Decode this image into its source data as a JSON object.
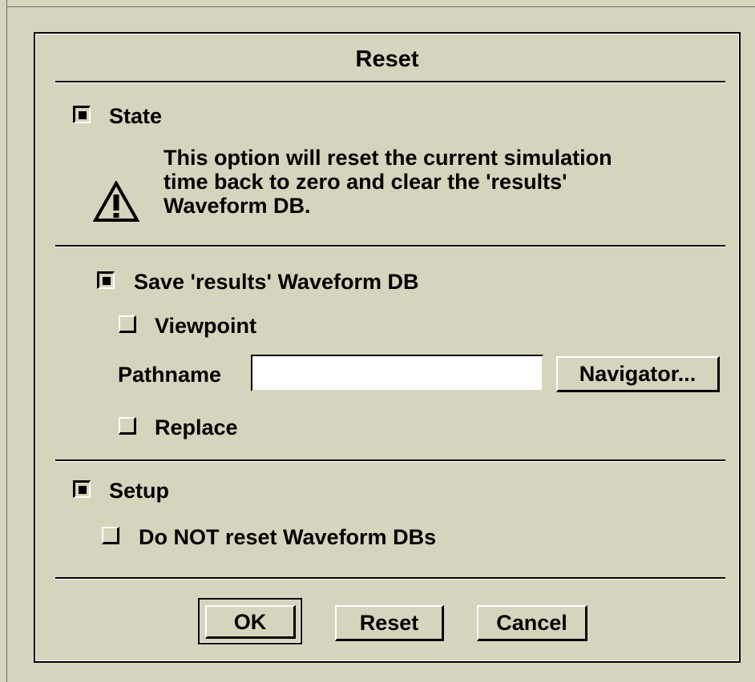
{
  "dialog": {
    "title": "Reset"
  },
  "state": {
    "checked": true,
    "label": "State",
    "warning_icon": "warning-triangle-icon",
    "warning_lines": [
      "This option will reset the current simulation",
      "time back to zero and clear the 'results'",
      "Waveform DB."
    ]
  },
  "save": {
    "checked": true,
    "label": "Save 'results' Waveform DB",
    "viewpoint": {
      "checked": false,
      "label": "Viewpoint"
    },
    "pathname": {
      "label": "Pathname",
      "value": "",
      "placeholder": ""
    },
    "navigator_label": "Navigator...",
    "replace": {
      "checked": false,
      "label": "Replace"
    }
  },
  "setup": {
    "checked": true,
    "label": "Setup",
    "no_reset": {
      "checked": false,
      "label": "Do NOT reset Waveform DBs"
    }
  },
  "buttons": {
    "ok": "OK",
    "reset": "Reset",
    "cancel": "Cancel"
  },
  "colors": {
    "background": "#d6d4bd",
    "text": "#000000",
    "highlight": "#ffffff"
  }
}
